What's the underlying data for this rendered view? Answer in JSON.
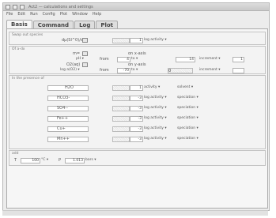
{
  "window": {
    "title": "Act2 — calculations and settings"
  },
  "menu": [
    "File",
    "Edit",
    "Run",
    "Config",
    "Plot",
    "Window",
    "Help"
  ],
  "tabs": [
    "Basis",
    "Command",
    "Log",
    "Plot"
  ],
  "sections": {
    "s1": {
      "title": "Swap out species",
      "row": {
        "label": "dμ(Sl^0)/dt=",
        "count": "1",
        "unit": "log activity"
      }
    },
    "s2": {
      "title": "Of a-dx",
      "rows": [
        {
          "label": "m=",
          "col2": "on x-axis"
        },
        {
          "label": "pH",
          "from": "from",
          "val": "4",
          "to": "to",
          "end": "14",
          "mode": "increment",
          "step": "1"
        },
        {
          "label": "O2(aq)",
          "col2": "on y-axis"
        },
        {
          "label": "log a(O2)",
          "from": "from",
          "val": "-70",
          "to": "to",
          "end": "0",
          "mode": "increment",
          "step": ""
        }
      ]
    },
    "s3": {
      "title": "In the presence of",
      "rows": [
        {
          "label": "H2O",
          "count": "1",
          "unit": "activity",
          "kind": "solvent"
        },
        {
          "label": "HCO3-",
          "count": "-3",
          "unit": "log activity",
          "kind": "speciation"
        },
        {
          "label": "SO4--",
          "count": "-3",
          "unit": "log activity",
          "kind": "speciation"
        },
        {
          "label": "Fe++",
          "count": "-3",
          "unit": "log activity",
          "kind": "speciation"
        },
        {
          "label": "Cu+",
          "count": "-3",
          "unit": "log activity",
          "kind": "speciation"
        },
        {
          "label": "Mn++",
          "count": "-3",
          "unit": "log activity",
          "kind": "speciation"
        }
      ]
    },
    "s4": {
      "title": "add",
      "t": "T",
      "t_val": "100",
      "t_unit": "°C",
      "p": "P",
      "p_val": "1.013",
      "p_unit": "bars"
    }
  }
}
